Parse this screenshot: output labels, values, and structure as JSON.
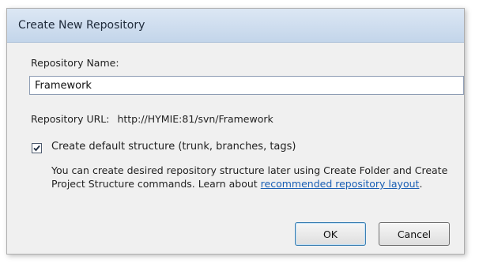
{
  "dialog": {
    "title": "Create New Repository",
    "repository_name_label": "Repository Name:",
    "repository_name_value": "Framework",
    "repository_url_label": "Repository URL:",
    "repository_url_value": "http://HYMIE:81/svn/Framework",
    "create_default_structure": {
      "checked": true,
      "label": "Create default structure (trunk, branches, tags)"
    },
    "hint": {
      "text": "You can create desired repository structure later using Create Folder and Create Project Structure commands. Learn about ",
      "link_text": "recommended repository layout",
      "suffix": "."
    },
    "buttons": {
      "ok": "OK",
      "cancel": "Cancel"
    }
  }
}
